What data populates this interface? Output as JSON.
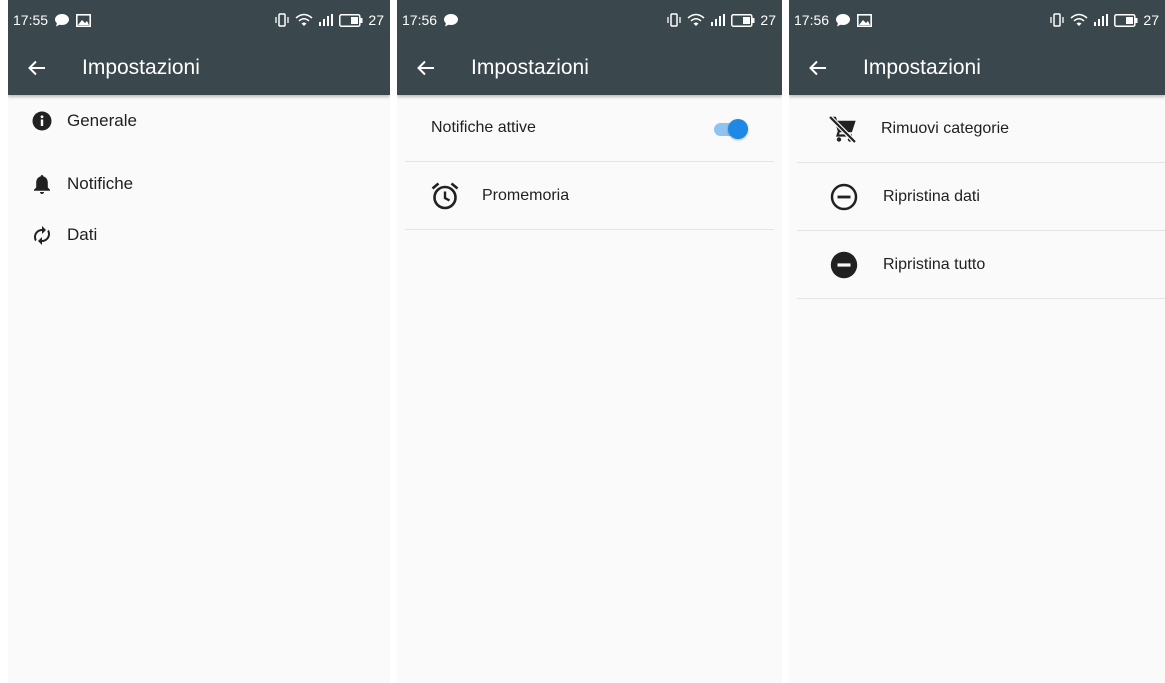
{
  "screens": [
    {
      "time": "17:55",
      "battery": "27",
      "title": "Impostazioni",
      "items": [
        {
          "label": "Generale",
          "icon": "info-icon"
        },
        {
          "label": "Notifiche",
          "icon": "bell-icon"
        },
        {
          "label": "Dati",
          "icon": "sync-icon"
        }
      ]
    },
    {
      "time": "17:56",
      "battery": "27",
      "title": "Impostazioni",
      "toggle_label": "Notifiche attive",
      "toggle_on": true,
      "reminder_label": "Promemoria"
    },
    {
      "time": "17:56",
      "battery": "27",
      "title": "Impostazioni",
      "items": [
        {
          "label": "Rimuovi categorie",
          "icon": "remove-shopping-cart-icon"
        },
        {
          "label": "Ripristina dati",
          "icon": "remove-circle-outline-icon"
        },
        {
          "label": "Ripristina tutto",
          "icon": "remove-circle-icon"
        }
      ]
    }
  ],
  "colors": {
    "toolbar": "#3a474c",
    "background": "#fafafa",
    "accent": "#1e88e5",
    "accent_track": "#8fc4f0"
  }
}
